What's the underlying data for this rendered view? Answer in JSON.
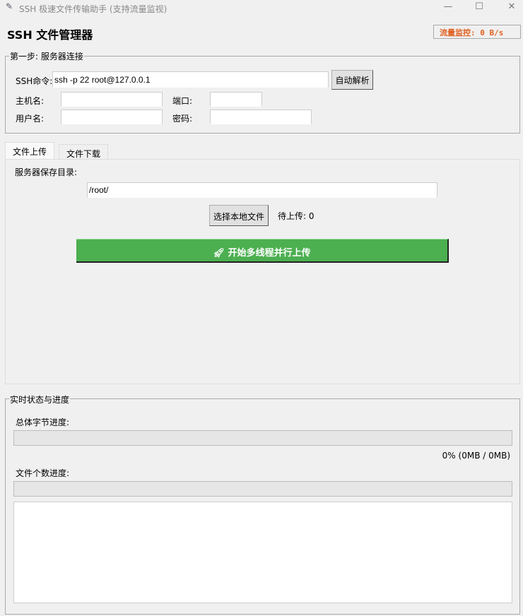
{
  "window": {
    "title": "SSH 极速文件传输助手 (支持流量监视)",
    "min": "—",
    "max": "☐",
    "close": "✕"
  },
  "header": {
    "title": "SSH 文件管理器",
    "monitor": "流量监控: 0 B/s"
  },
  "connect": {
    "legend": "第一步: 服务器连接",
    "ssh_label": "SSH命令:",
    "ssh_value": "ssh -p 22 root@127.0.0.1",
    "parse_btn": "自动解析",
    "host_label": "主机名:",
    "host_value": "",
    "port_label": "端口:",
    "port_value": "",
    "user_label": "用户名:",
    "user_value": "",
    "pass_label": "密码:",
    "pass_value": ""
  },
  "tabs": [
    {
      "label": "文件上传"
    },
    {
      "label": "文件下载"
    }
  ],
  "upload": {
    "dir_label": "服务器保存目录:",
    "dir_value": "/root/",
    "choose_btn": "选择本地文件",
    "pending": "待上传: 0",
    "start_icon": "rocket-icon",
    "start_btn": "开始多线程并行上传",
    "accent": "#4caf50"
  },
  "status": {
    "legend": "实时状态与进度",
    "bytes_label": "总体字节进度:",
    "bytes_progress": 0,
    "bytes_text": "0% (0MB / 0MB)",
    "files_label": "文件个数进度:",
    "files_progress": 0,
    "log": ""
  }
}
